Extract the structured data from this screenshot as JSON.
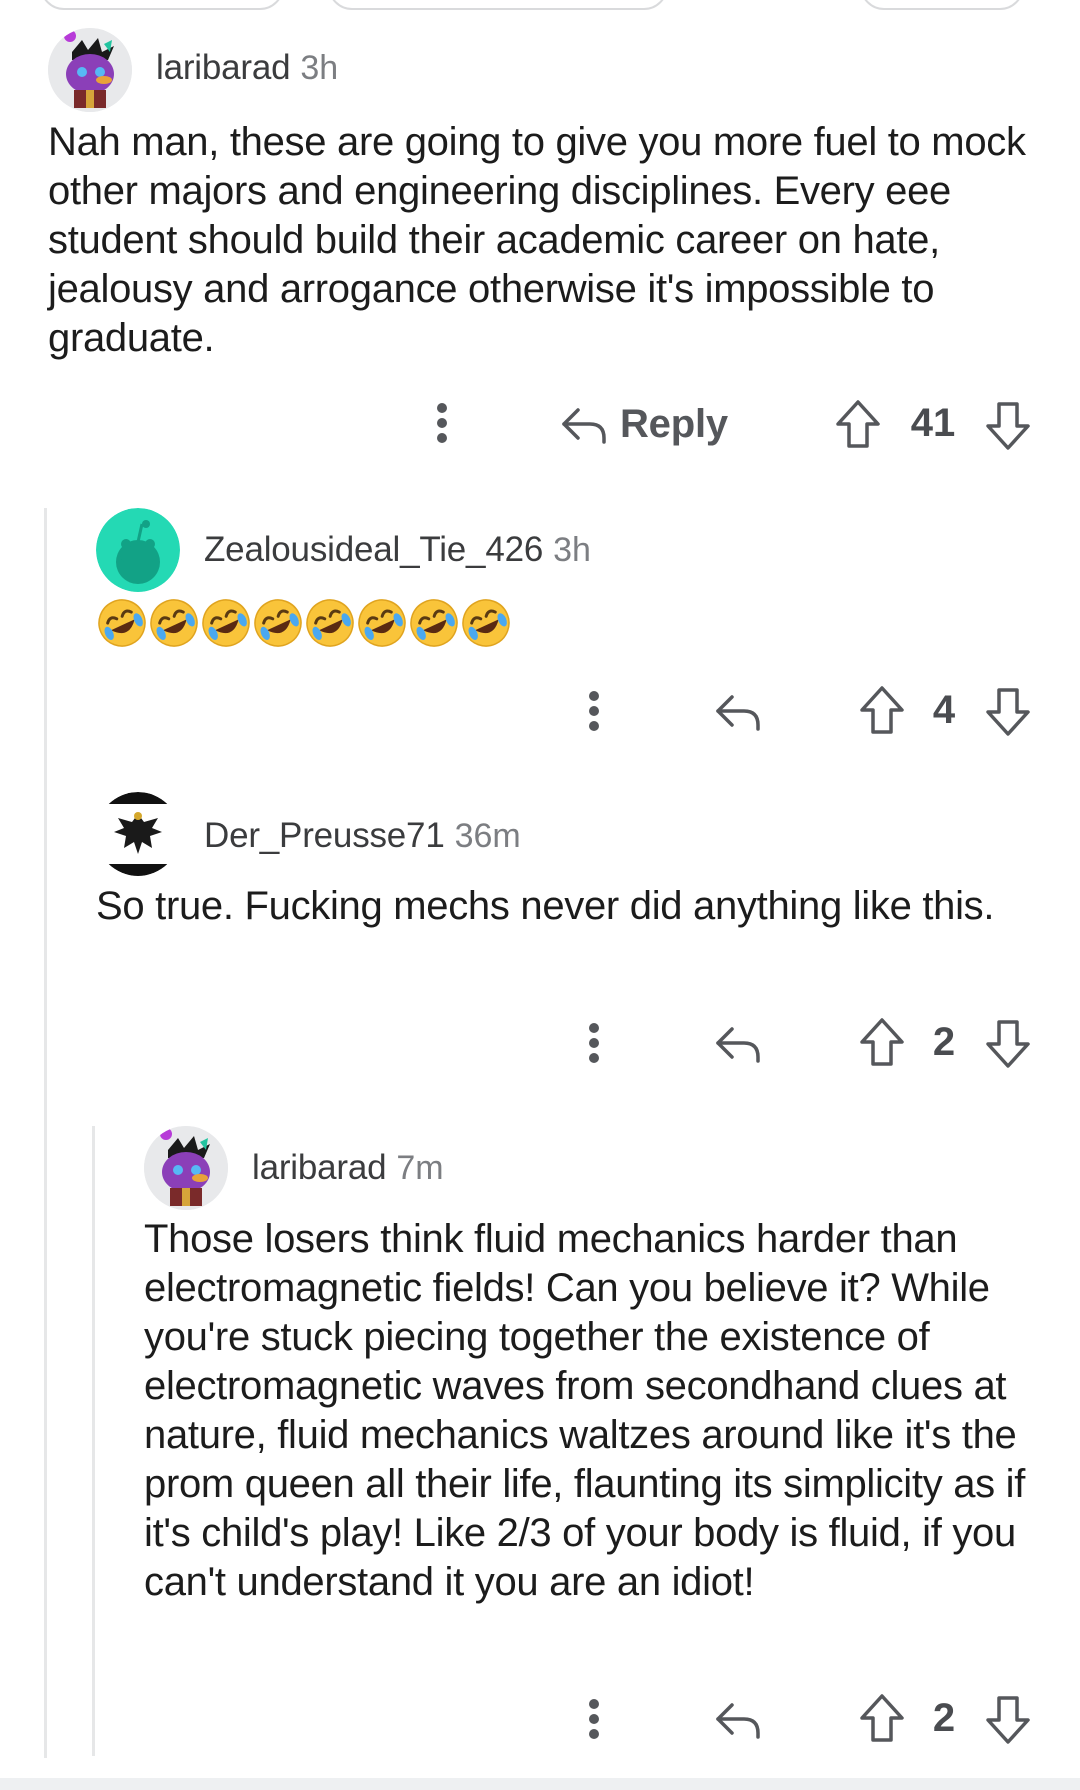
{
  "comments": [
    {
      "username": "laribarad",
      "time": "3h",
      "body": "Nah man, these are going to give you more fuel to mock other majors and engineering disciplines. Every eee student should build their academic career on hate, jealousy and arrogance otherwise it's impossible to graduate.",
      "reply_label": "Reply",
      "score": "41",
      "avatar_icon": "snoo-purple-avatar"
    },
    {
      "username": "Zealousideal_Tie_426",
      "time": "3h",
      "body_emoji": "rolling-on-floor-laughing",
      "emoji_count": 8,
      "score": "4",
      "avatar_icon": "default-snoo-avatar"
    },
    {
      "username": "Der_Preusse71",
      "time": "36m",
      "body": "So true. Fucking mechs never did anything like this.",
      "score": "2",
      "avatar_icon": "prussian-eagle-flag-avatar"
    },
    {
      "username": "laribarad",
      "time": "7m",
      "body": "Those losers think fluid mechanics harder than electromagnetic fields! Can you believe it? While you're stuck piecing together the existence of electromagnetic waves from secondhand clues at nature, fluid mechanics waltzes around like it's the prom queen all their life, flaunting its simplicity as if it's child's play! Like 2/3 of your body is fluid, if you can't understand it you are an idiot!",
      "score": "2",
      "avatar_icon": "snoo-purple-avatar"
    }
  ],
  "colors": {
    "meta_gray": "#7c7e82",
    "icon_gray": "#55575b",
    "thread_line": "#e6e7e8",
    "default_avatar_bg": "#24d9b4"
  }
}
